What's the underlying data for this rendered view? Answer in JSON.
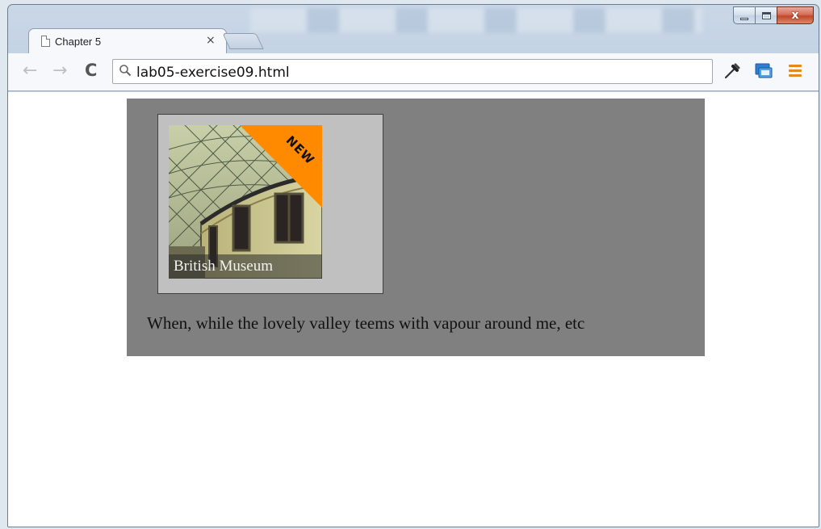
{
  "browser": {
    "tab": {
      "title": "Chapter 5",
      "close_glyph": "×"
    },
    "toolbar": {
      "back_glyph": "←",
      "forward_glyph": "→",
      "reload_glyph": "C",
      "address": "lab05-exercise09.html"
    },
    "window_controls": {
      "close_glyph": "x"
    }
  },
  "page": {
    "figure": {
      "caption": "British Museum",
      "badge": "NEW"
    },
    "paragraph": "When, while the lovely valley teems with vapour around me, etc"
  },
  "colors": {
    "content_box_bg": "#808080",
    "figure_bg": "#c0c0c0",
    "badge_orange": "#ff8a00",
    "menu_orange": "#e58a1a"
  }
}
